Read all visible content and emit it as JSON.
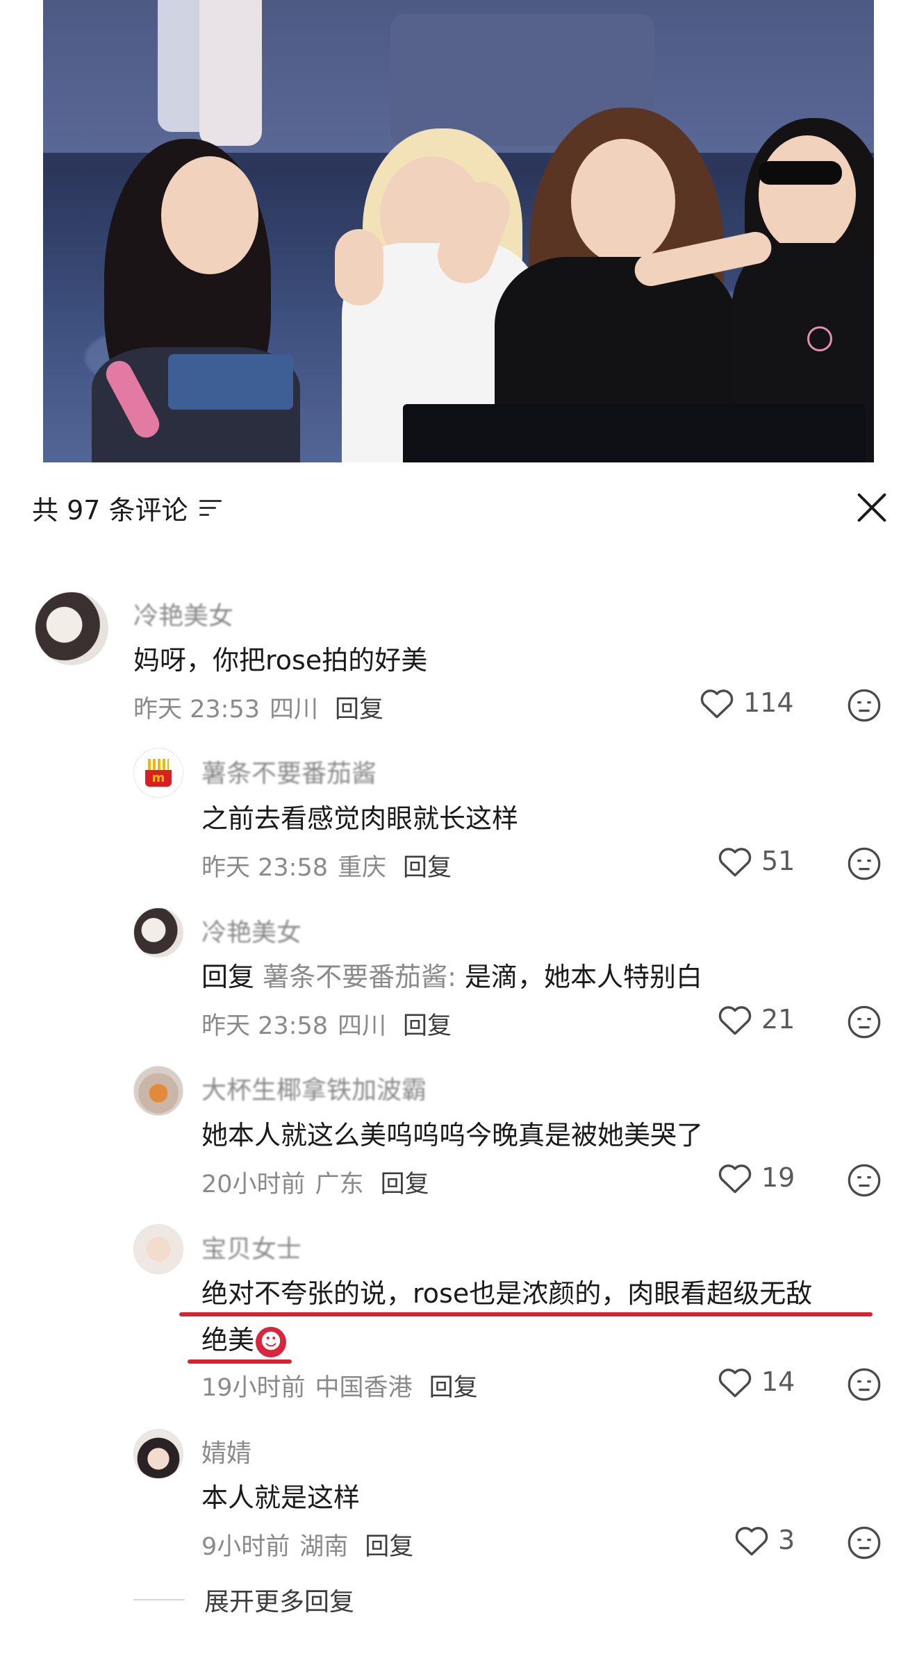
{
  "header": {
    "comment_count_label": "共 97 条评论"
  },
  "comments": [
    {
      "username": "冷艳美女",
      "text": "妈呀，你把rose拍的好美",
      "time": "昨天 23:53",
      "location": "四川",
      "reply_label": "回复",
      "likes": "114"
    },
    {
      "username": "薯条不要番茄酱",
      "text": "之前去看感觉肉眼就长这样",
      "time": "昨天 23:58",
      "location": "重庆",
      "reply_label": "回复",
      "likes": "51"
    },
    {
      "username": "冷艳美女",
      "reply_prefix": "回复",
      "reply_target": "薯条不要番茄酱:",
      "text": "是滴，她本人特别白",
      "time": "昨天 23:58",
      "location": "四川",
      "reply_label": "回复",
      "likes": "21"
    },
    {
      "username": "大杯生椰拿铁加波霸",
      "text": "她本人就这么美呜呜呜今晚真是被她美哭了",
      "time": "20小时前",
      "location": "广东",
      "reply_label": "回复",
      "likes": "19"
    },
    {
      "username": "宝贝女士",
      "text_line1": "绝对不夸张的说，rose也是浓颜的，肉眼看超级无敌",
      "text_line2": "绝美",
      "emoji": "😈",
      "time": "19小时前",
      "location": "中国香港",
      "reply_label": "回复",
      "likes": "14"
    },
    {
      "username": "婧婧",
      "text": "本人就是这样",
      "time": "9小时前",
      "location": "湖南",
      "reply_label": "回复",
      "likes": "3"
    }
  ],
  "expand_label": "展开更多回复",
  "colors": {
    "underline": "#d8222f",
    "secondary_text": "#8a8a8a"
  }
}
